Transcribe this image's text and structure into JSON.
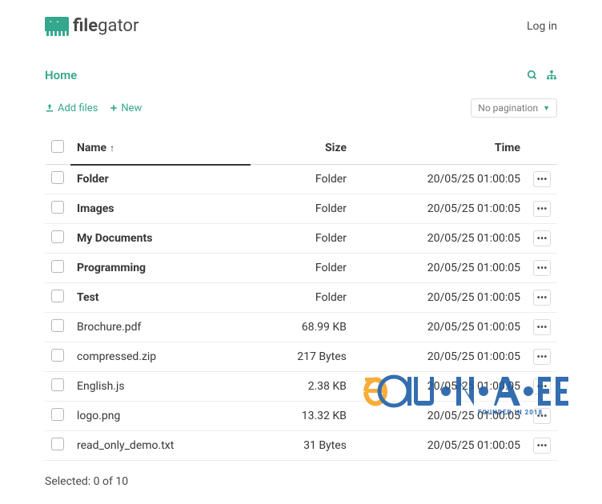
{
  "header": {
    "logo_text_1": "file",
    "logo_text_2": "gator",
    "login": "Log in"
  },
  "breadcrumb": {
    "home": "Home"
  },
  "actions": {
    "add_files": "Add files",
    "new": "New",
    "pagination": "No pagination"
  },
  "table": {
    "headers": {
      "name": "Name",
      "size": "Size",
      "time": "Time"
    },
    "rows": [
      {
        "name": "Folder",
        "size": "Folder",
        "time": "20/05/25 01:00:05",
        "bold": true
      },
      {
        "name": "Images",
        "size": "Folder",
        "time": "20/05/25 01:00:05",
        "bold": true
      },
      {
        "name": "My Documents",
        "size": "Folder",
        "time": "20/05/25 01:00:05",
        "bold": true
      },
      {
        "name": "Programming",
        "size": "Folder",
        "time": "20/05/25 01:00:05",
        "bold": true
      },
      {
        "name": "Test",
        "size": "Folder",
        "time": "20/05/25 01:00:05",
        "bold": true
      },
      {
        "name": "Brochure.pdf",
        "size": "68.99 KB",
        "time": "20/05/25 01:00:05",
        "bold": false
      },
      {
        "name": "compressed.zip",
        "size": "217 Bytes",
        "time": "20/05/25 01:00:05",
        "bold": false
      },
      {
        "name": "English.js",
        "size": "2.38 KB",
        "time": "20/05/25 01:00:05",
        "bold": false
      },
      {
        "name": "logo.png",
        "size": "13.32 KB",
        "time": "20/05/25 01:00:05",
        "bold": false
      },
      {
        "name": "read_only_demo.txt",
        "size": "31 Bytes",
        "time": "20/05/25 01:00:05",
        "bold": false
      }
    ]
  },
  "footer": {
    "selected": "Selected: 0 of 10"
  },
  "watermark": {
    "brand": "DUNIAWEB",
    "tagline": "FOUNDED IN 2018"
  }
}
